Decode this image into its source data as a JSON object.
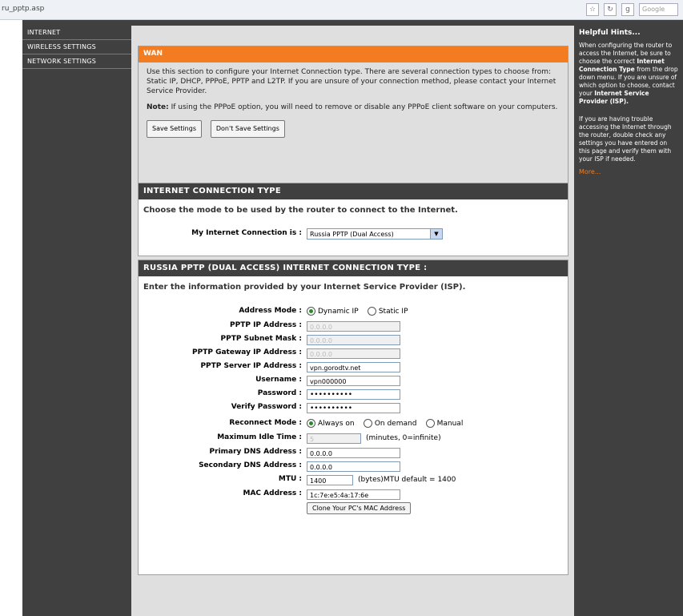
{
  "browser": {
    "url": "ru_pptp.asp",
    "search_placeholder": "Google"
  },
  "nav": {
    "items": [
      {
        "label": "INTERNET"
      },
      {
        "label": "WIRELESS SETTINGS"
      },
      {
        "label": "NETWORK SETTINGS"
      }
    ]
  },
  "wan": {
    "title": "WAN",
    "description": "Use this section to configure your Internet Connection type. There are several connection types to choose from: Static IP, DHCP, PPPoE, PPTP and L2TP. If you are unsure of your connection method, please contact your Internet Service Provider.",
    "note_label": "Note:",
    "note_text": " If using the PPPoE option, you will need to remove or disable any PPPoE client software on your computers.",
    "save_label": "Save Settings",
    "dont_save_label": "Don't Save Settings"
  },
  "connection_type": {
    "title": "INTERNET CONNECTION TYPE",
    "subtitle": "Choose the mode to be used by the router to connect to the Internet.",
    "select_label": "My Internet Connection is :",
    "select_value": "Russia PPTP (Dual Access)"
  },
  "pptp": {
    "title": "RUSSIA PPTP (DUAL ACCESS) INTERNET CONNECTION TYPE :",
    "subtitle": "Enter the information provided by your Internet Service Provider (ISP).",
    "address_mode_label": "Address Mode :",
    "address_mode_options": [
      "Dynamic IP",
      "Static IP"
    ],
    "ip_label": "PPTP IP Address :",
    "ip_value": "0.0.0.0",
    "mask_label": "PPTP Subnet Mask :",
    "mask_value": "0.0.0.0",
    "gateway_label": "PPTP Gateway IP Address :",
    "gateway_value": "0.0.0.0",
    "server_label": "PPTP Server IP Address :",
    "server_value": "vpn.gorodtv.net",
    "username_label": "Username :",
    "username_value": "vpn000000",
    "password_label": "Password :",
    "password_value": "••••••••••",
    "verify_label": "Verify Password :",
    "verify_value": "••••••••••",
    "reconnect_label": "Reconnect Mode :",
    "reconnect_options": [
      "Always on",
      "On demand",
      "Manual"
    ],
    "idle_label": "Maximum Idle Time :",
    "idle_value": "5",
    "idle_suffix": "(minutes, 0=infinite)",
    "dns1_label": "Primary DNS Address :",
    "dns1_value": "0.0.0.0",
    "dns2_label": "Secondary DNS Address :",
    "dns2_value": "0.0.0.0",
    "mtu_label": "MTU :",
    "mtu_value": "1400",
    "mtu_suffix": "(bytes)MTU default = 1400",
    "mac_label": "MAC Address :",
    "mac_value": "1c:7e:e5:4a:17:6e",
    "clone_label": "Clone Your PC's MAC Address"
  },
  "help": {
    "title": "Helpful Hints...",
    "p1_a": "When configuring the router to access the Internet, be sure to choose the correct ",
    "p1_b": "Internet Connection Type",
    "p1_c": " from the drop down menu. If you are unsure of which option to choose, contact your ",
    "p1_d": "Internet Service Provider (ISP).",
    "p2": "If you are having trouble accessing the Internet through the router, double check any settings you have entered on this page and verify them with your ISP if needed.",
    "more": "More..."
  }
}
